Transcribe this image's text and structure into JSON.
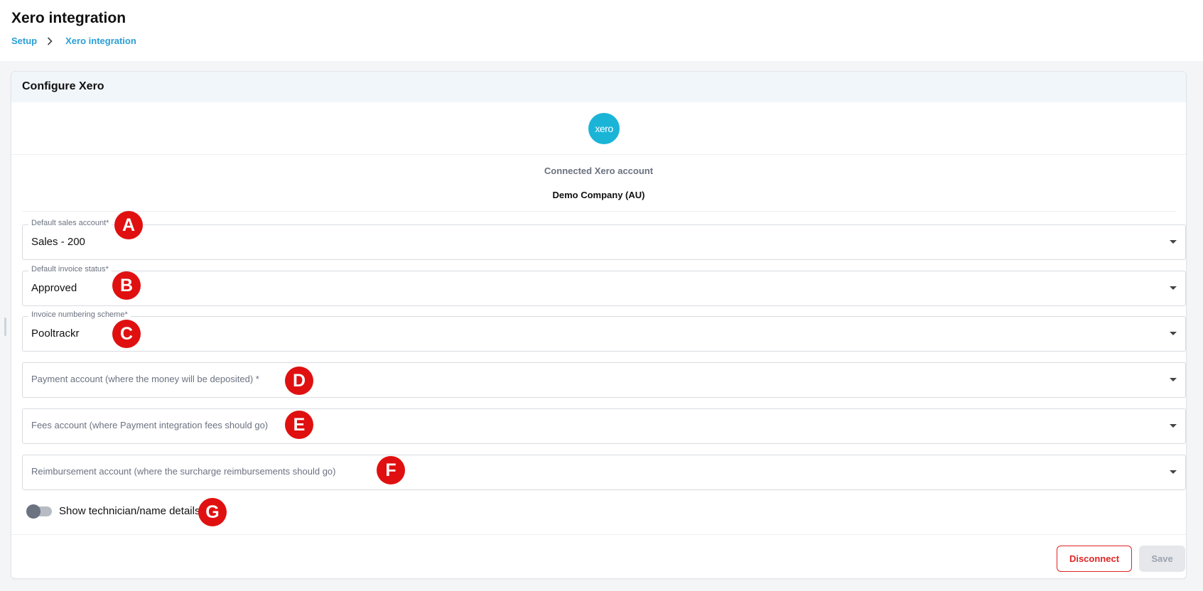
{
  "header": {
    "title": "Xero integration",
    "breadcrumb": [
      "Setup",
      "Xero integration"
    ]
  },
  "card": {
    "title": "Configure Xero",
    "logo_text": "xero",
    "connected_label": "Connected Xero account",
    "connected_value": "Demo Company (AU)"
  },
  "fields": {
    "sales_account": {
      "label": "Default sales account",
      "required": "*",
      "value": "Sales - 200"
    },
    "invoice_status": {
      "label": "Default invoice status",
      "required": "*",
      "value": "Approved"
    },
    "numbering_scheme": {
      "label": "Invoice numbering scheme",
      "required": "*",
      "value": "Pooltrackr"
    },
    "payment_account": {
      "placeholder": "Payment account (where the money will be deposited)",
      "required": "*"
    },
    "fees_account": {
      "placeholder": "Fees account (where Payment integration fees should go)"
    },
    "reimbursement_account": {
      "placeholder": "Reimbursement account (where the surcharge reimbursements should go)"
    }
  },
  "toggle": {
    "label": "Show technician/name details",
    "checked": false
  },
  "markers": [
    "A",
    "B",
    "C",
    "D",
    "E",
    "F",
    "G"
  ],
  "buttons": {
    "disconnect": "Disconnect",
    "save": "Save"
  },
  "colors": {
    "accent": "#2a9fd6",
    "xero": "#1ab4d7",
    "danger": "#e02424",
    "marker": "#e01010"
  }
}
